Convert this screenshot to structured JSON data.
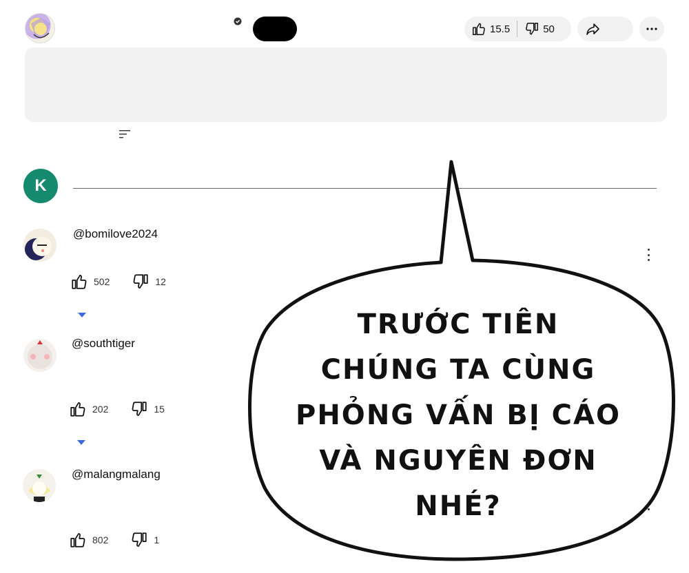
{
  "header": {
    "likes": "15.5",
    "dislikes": "50"
  },
  "add_comment": {
    "avatar_letter": "K"
  },
  "comments": [
    {
      "handle": "@bomilove2024",
      "likes": "502",
      "dislikes": "12"
    },
    {
      "handle": "@southtiger",
      "likes": "202",
      "dislikes": "15"
    },
    {
      "handle": "@malangmalang",
      "likes": "802",
      "dislikes": "1"
    }
  ],
  "overlay": {
    "speech_bubble_lines": [
      "TRƯỚC TIÊN",
      "CHÚNG TA CÙNG",
      "PHỎNG VẤN BỊ CÁO",
      "VÀ NGUYÊN ĐƠN",
      "NHÉ?"
    ]
  },
  "colors": {
    "user_avatar": "#168a6e",
    "pill_bg": "#f2f2f2",
    "reply_toggle": "#3e6ae1"
  },
  "icons": [
    "verified-icon",
    "thumbs-up-icon",
    "thumbs-down-icon",
    "share-icon",
    "more-icon",
    "sort-icon",
    "kebab-icon",
    "chevron-down-icon"
  ]
}
